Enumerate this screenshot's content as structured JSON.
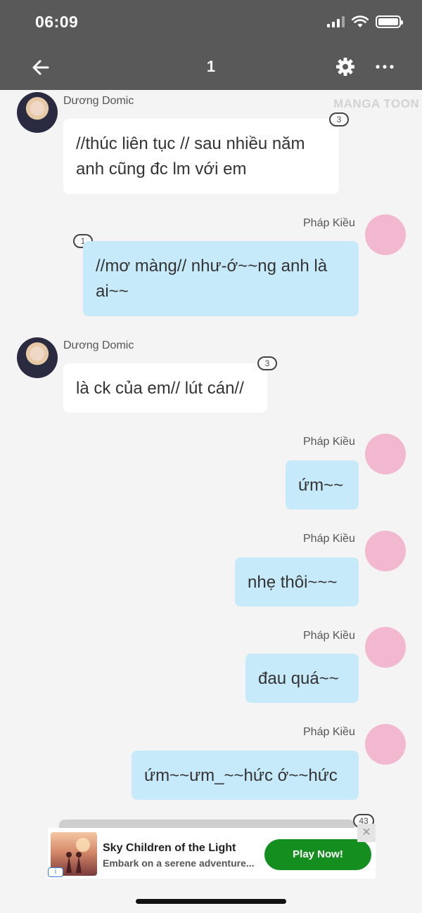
{
  "status_bar": {
    "time": "06:09"
  },
  "nav": {
    "title": "1"
  },
  "watermark": "MANGA TOON",
  "messages": [
    {
      "side": "left",
      "name": "Dương Domic",
      "text": "//thúc liên tục // sau nhiều năm anh cũng đc lm với em",
      "count": "3"
    },
    {
      "side": "right",
      "name": "Pháp Kiều",
      "text": "//mơ màng// như-ớ~~ng anh là ai~~",
      "count": "1"
    },
    {
      "side": "left",
      "name": "Dương Domic",
      "text": "là ck của em// lút cán//",
      "count": "3"
    },
    {
      "side": "right",
      "name": "Pháp Kiều",
      "text": "ứm~~"
    },
    {
      "side": "right",
      "name": "Pháp Kiều",
      "text": "nhẹ thôi~~~"
    },
    {
      "side": "right",
      "name": "Pháp Kiều",
      "text": "đau quá~~"
    },
    {
      "side": "right",
      "name": "Pháp Kiều",
      "text": "ứm~~ưm_~~hức ớ~~hức"
    }
  ],
  "ad": {
    "title": "Sky Children of the Light",
    "subtitle": "Embark on a serene adventure...",
    "cta": "Play Now!",
    "info_label": "i",
    "close_label": "✕",
    "count": "43"
  },
  "colors": {
    "header_bg": "#595959",
    "bubble_left": "#ffffff",
    "bubble_right": "#c7eafb",
    "cta_green": "#148e1f"
  }
}
